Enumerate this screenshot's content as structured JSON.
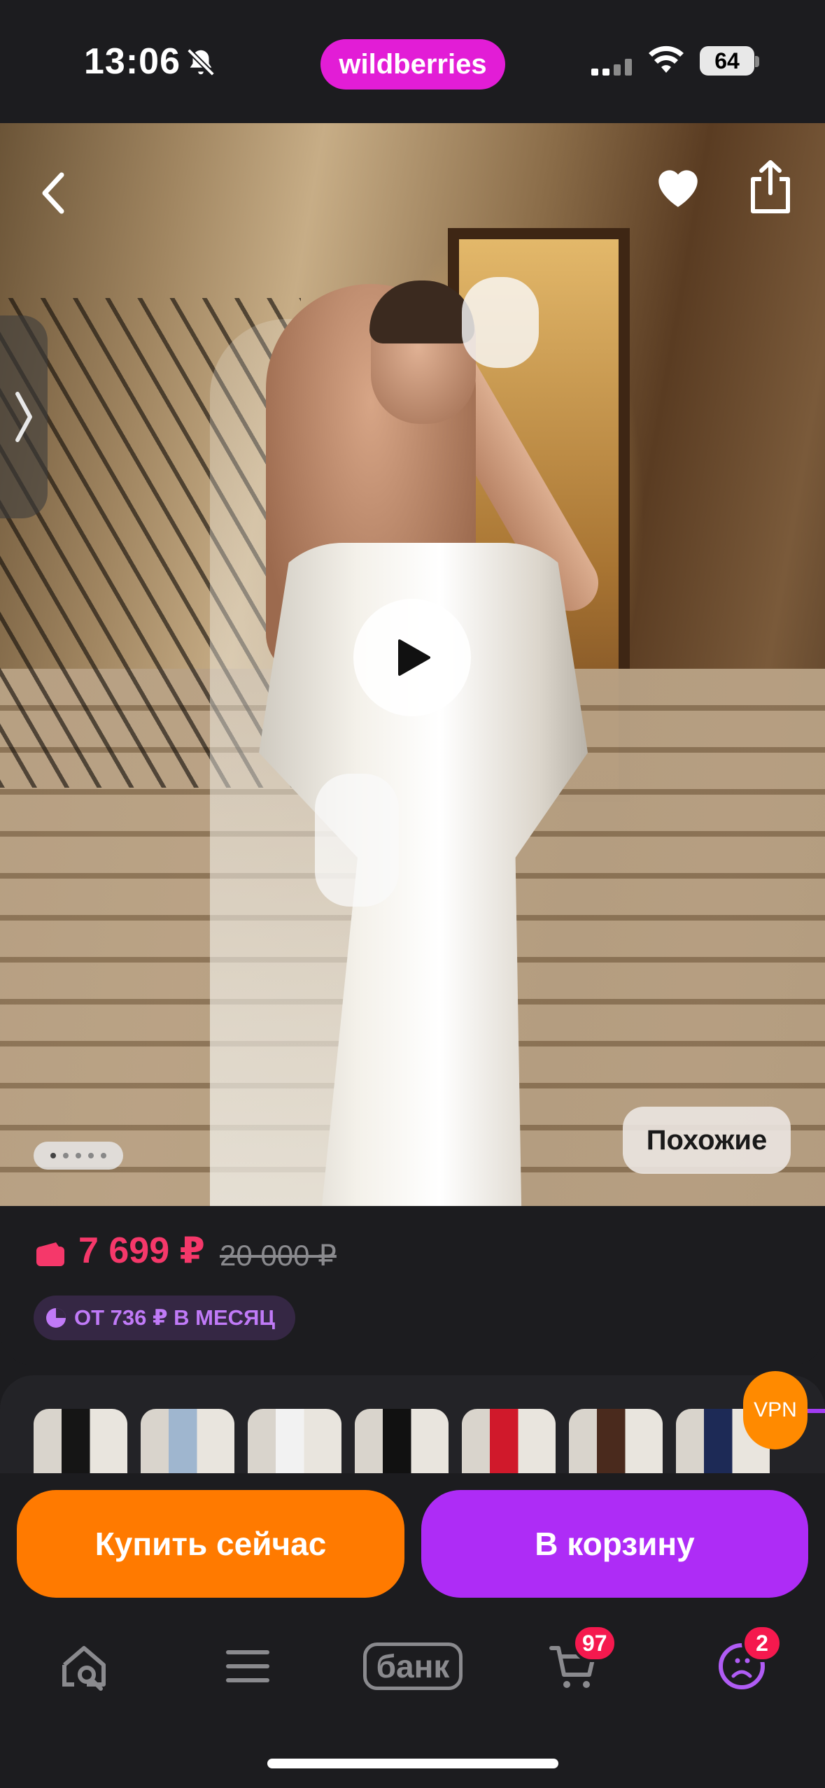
{
  "status_bar": {
    "time": "13:06",
    "brand": "wildberries",
    "battery": "64"
  },
  "gallery": {
    "similar_label": "Похожие",
    "dots_total": 5,
    "dots_active": 1
  },
  "price": {
    "current": "7 699 ₽",
    "old": "20 000 ₽",
    "installment": "ОТ 736 ₽ В МЕСЯЦ",
    "accent_color": "#f5386a"
  },
  "variants": {
    "colors": [
      "#151515",
      "#9fb6cf",
      "#f2f2f2",
      "#111111",
      "#d0192b",
      "#4a2a1d",
      "#1d2a56"
    ],
    "vpn_label": "VPN"
  },
  "actions": {
    "buy_now": "Купить сейчас",
    "add_to_cart": "В корзину",
    "buy_color": "#ff7a00",
    "cart_color": "#ae2cf6"
  },
  "tab_bar": {
    "bank_label": "банк",
    "cart_badge": "97",
    "profile_badge": "2"
  }
}
